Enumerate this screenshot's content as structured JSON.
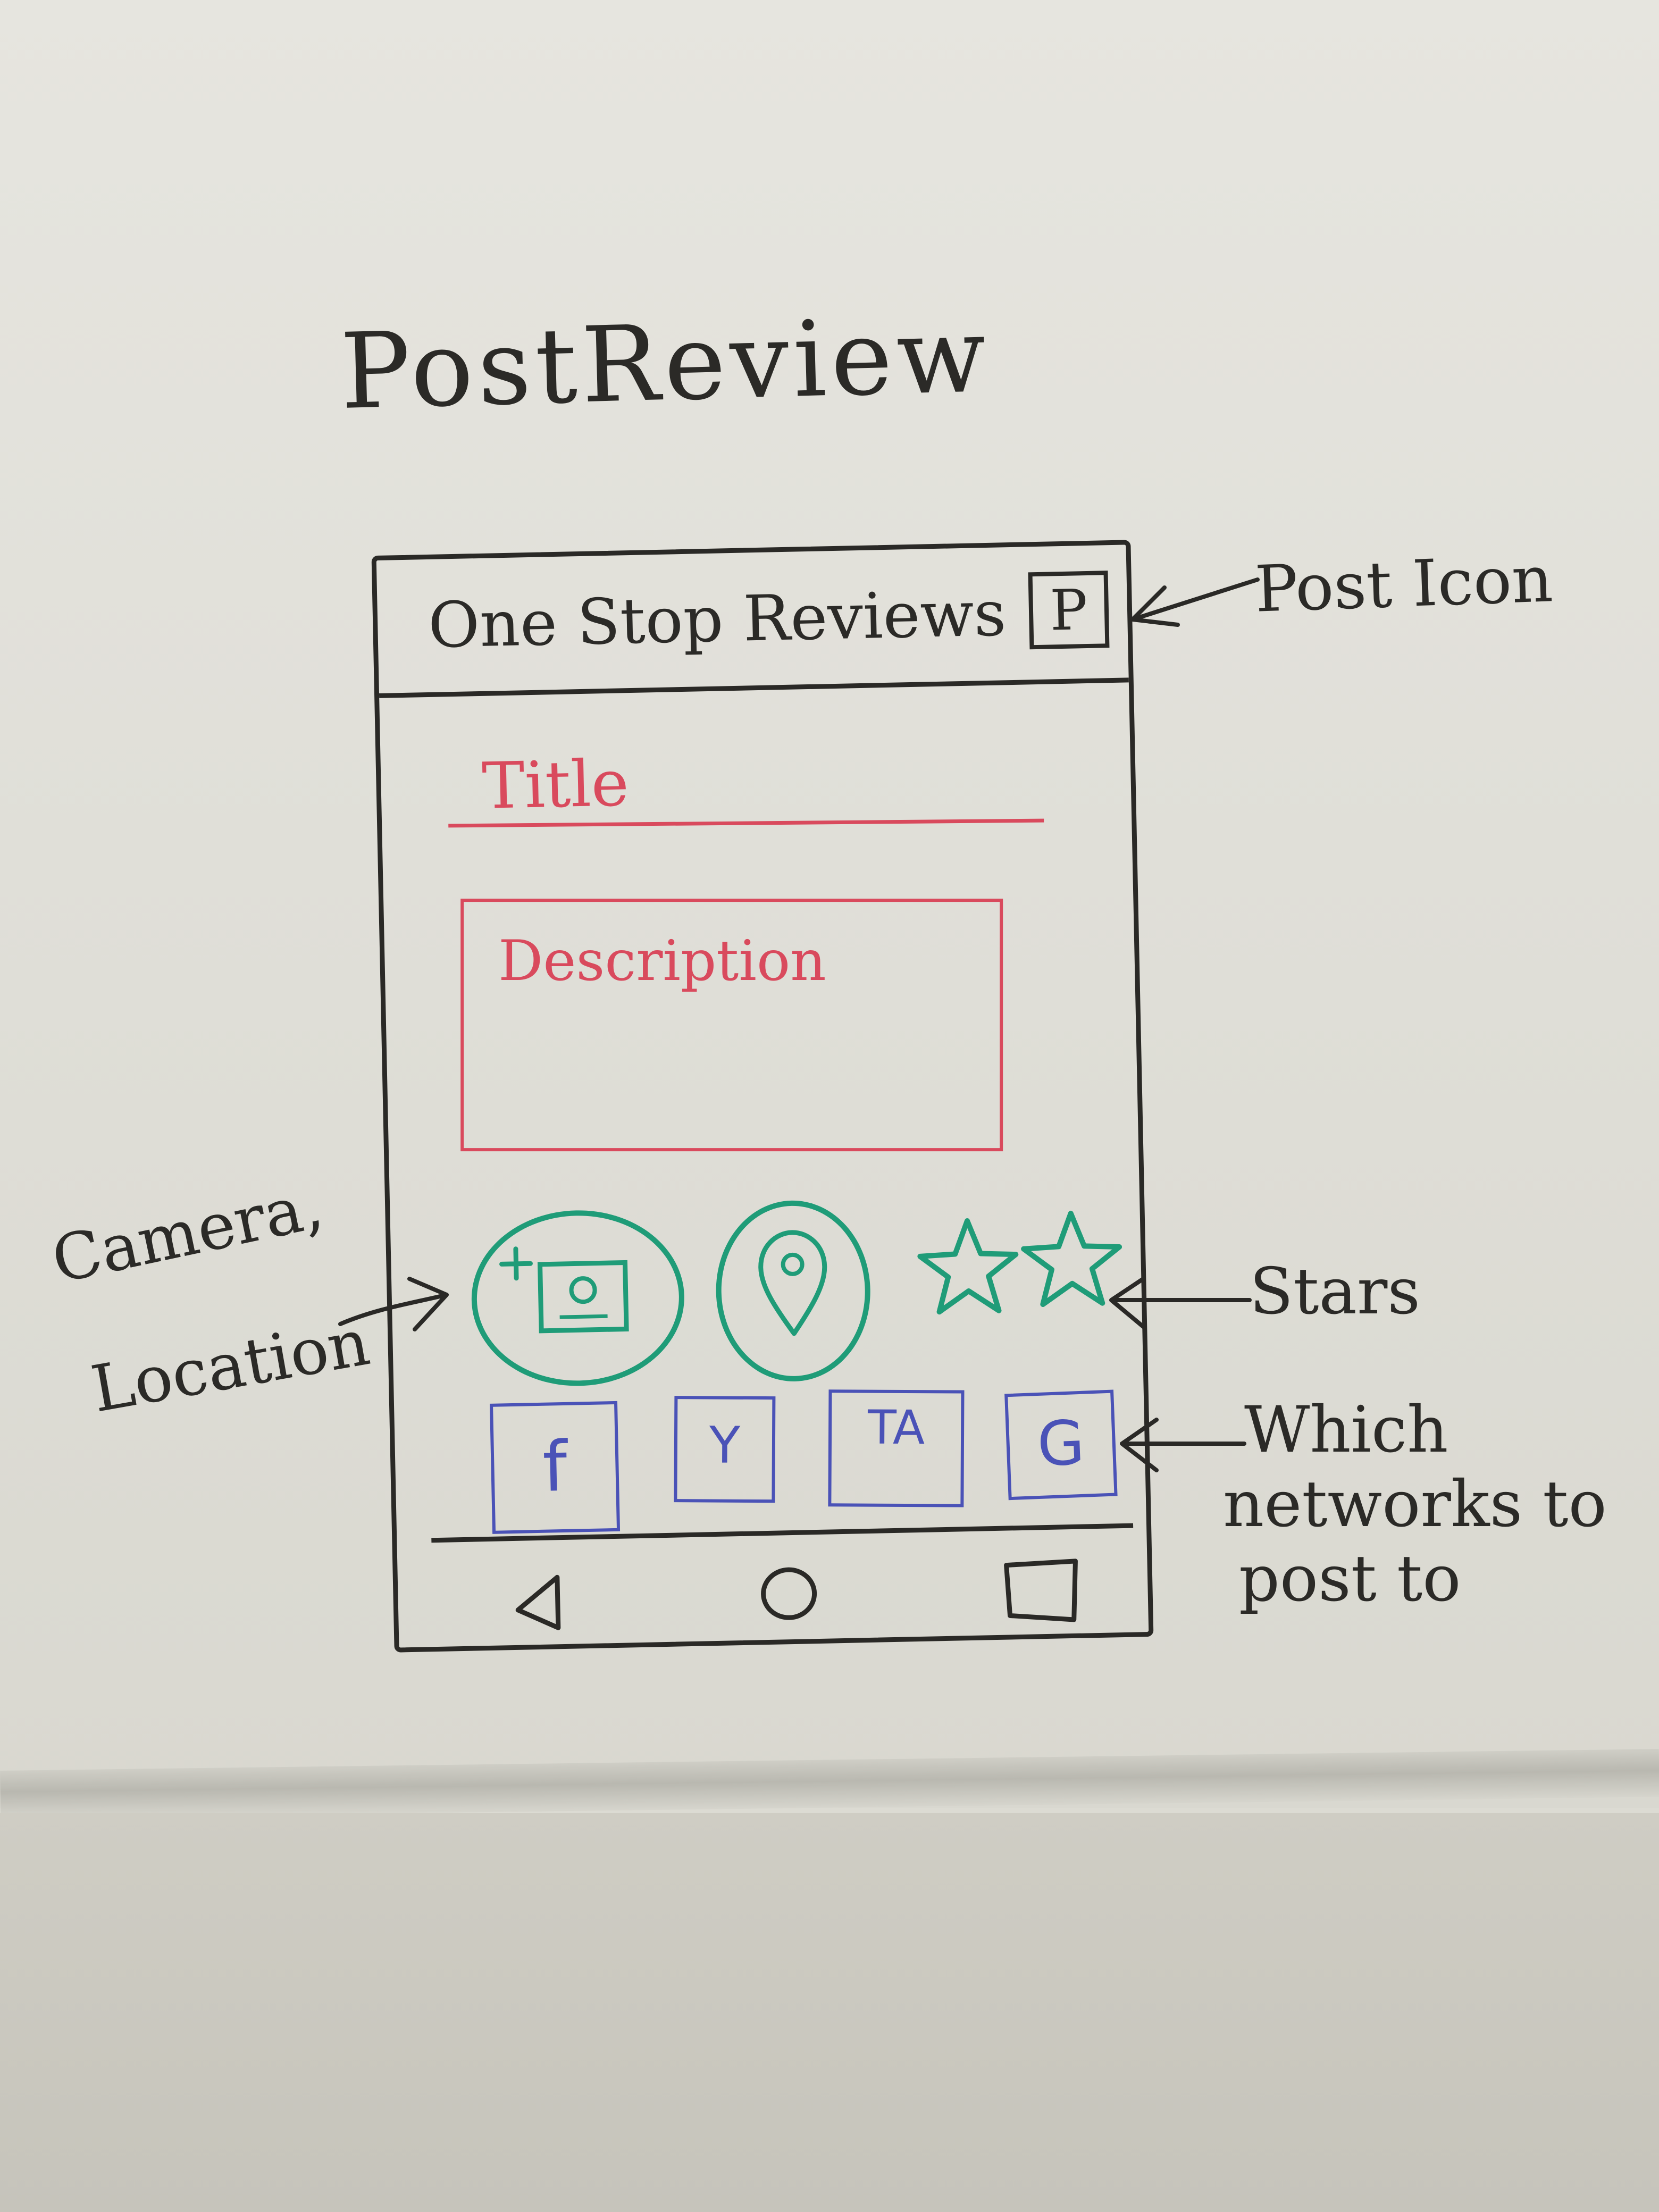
{
  "sketch": {
    "heading": "PostReview",
    "annotations": {
      "post_icon": "Post Icon",
      "camera_location": [
        "Camera,",
        "Location"
      ],
      "stars": "Stars",
      "networks": [
        "Which",
        "networks to",
        "post to"
      ]
    }
  },
  "app": {
    "title": "One Stop Reviews",
    "post_button_label": "P"
  },
  "form": {
    "title_placeholder": "Title",
    "description_placeholder": "Description"
  },
  "actions": {
    "camera_icon": "camera-plus-icon",
    "location_icon": "location-pin-icon",
    "star_count": 2
  },
  "networks": [
    {
      "label": "f",
      "icon": "facebook-icon"
    },
    {
      "label": "Y",
      "icon": "yelp-icon"
    },
    {
      "label": "TA",
      "icon": "tripadvisor-icon"
    },
    {
      "label": "G",
      "icon": "google-icon"
    }
  ],
  "navigation": {
    "icons": [
      "back-icon",
      "home-icon",
      "recent-apps-icon"
    ]
  },
  "colors": {
    "ink_black": "#2a2926",
    "ink_red": "#d94a5d",
    "ink_green": "#1f9c78",
    "ink_blue": "#4a52b7",
    "board": "#e3e2dc"
  }
}
